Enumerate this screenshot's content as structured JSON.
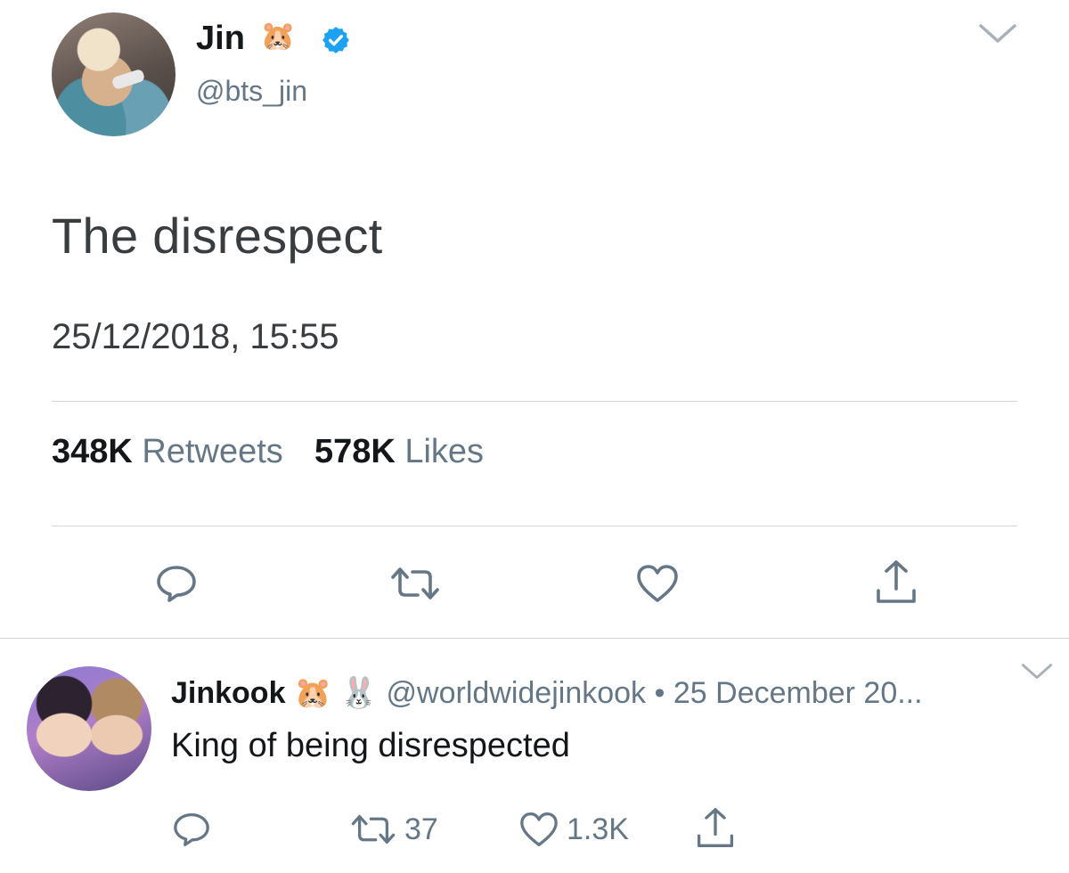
{
  "tweet": {
    "display_name": "Jin",
    "name_emoji": "🐹",
    "handle": "@bts_jin",
    "text": "The disrespect",
    "timestamp": "25/12/2018, 15:55",
    "retweets_count": "348K",
    "retweets_label": "Retweets",
    "likes_count": "578K",
    "likes_label": "Likes",
    "icons": [
      "reply-icon",
      "retweet-icon",
      "like-icon",
      "share-icon",
      "verified-icon",
      "chevron-down-icon"
    ]
  },
  "reply": {
    "display_name": "Jinkook",
    "emoji_1": "🐹",
    "emoji_2": "🐰",
    "handle": "@worldwidejinkook",
    "date": "25 December 20...",
    "separator": "•",
    "text": "King of being disrespected",
    "retweets_count": "37",
    "likes_count": "1.3K"
  },
  "colors": {
    "verified": "#1da1f2",
    "secondary_text": "#657786",
    "divider": "#cfd5db",
    "icon": "#657786"
  }
}
